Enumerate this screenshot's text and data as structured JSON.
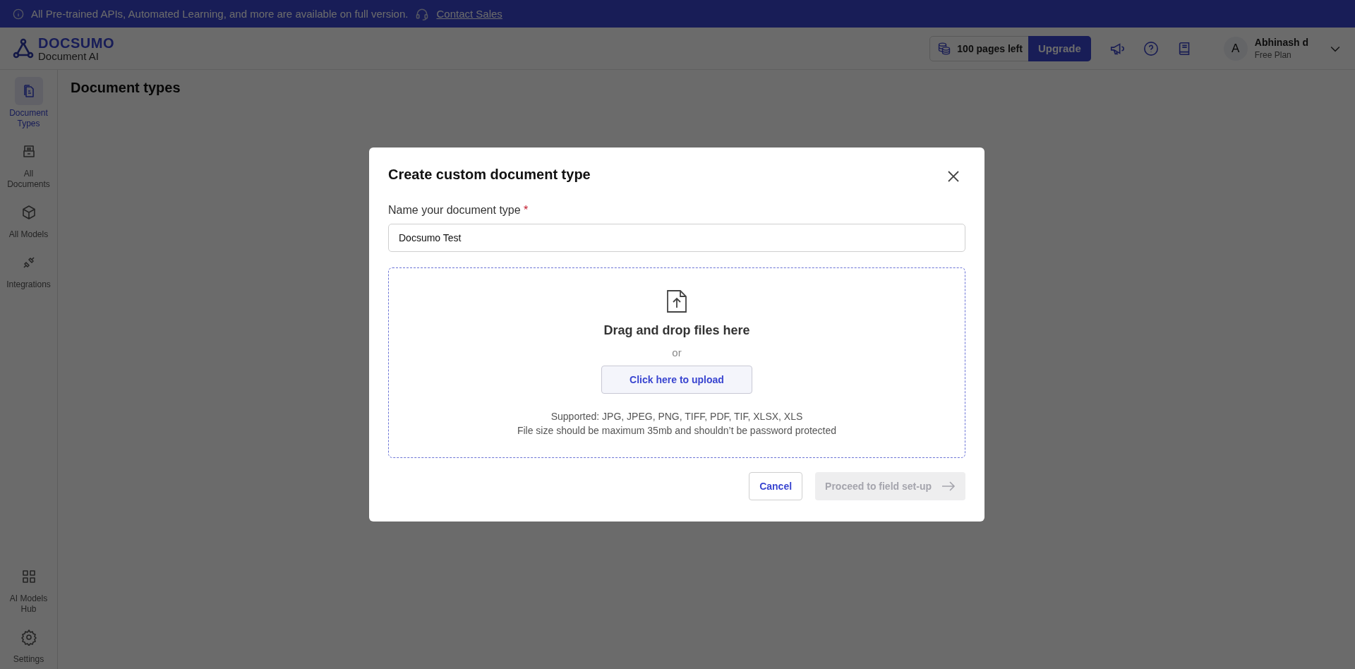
{
  "banner": {
    "text": "All Pre-trained APIs, Automated Learning, and more are available on full version.",
    "link": "Contact Sales"
  },
  "header": {
    "logo_name": "DOCSUMO",
    "logo_subtitle": "Document AI",
    "pages_left": "100 pages left",
    "upgrade": "Upgrade",
    "user": {
      "initial": "A",
      "name": "Abhinash d",
      "plan": "Free Plan"
    }
  },
  "sidebar": {
    "items": [
      {
        "kind": "doc-types",
        "label": "Document Types",
        "selected": true
      },
      {
        "kind": "all-docs",
        "label": "All Documents",
        "selected": false
      },
      {
        "kind": "models",
        "label": "All Models",
        "selected": false
      },
      {
        "kind": "integrations",
        "label": "Integrations",
        "selected": false
      }
    ],
    "bottom_items": [
      {
        "kind": "hub",
        "label": "AI Models Hub",
        "selected": false
      },
      {
        "kind": "settings",
        "label": "Settings",
        "selected": false
      }
    ]
  },
  "page": {
    "title": "Document types"
  },
  "modal": {
    "title": "Create custom document type",
    "field_label": "Name your document type",
    "required_mark": "*",
    "field_value": "Docsumo Test",
    "dropzone": {
      "heading": "Drag and drop files here",
      "or": "or",
      "button": "Click here to upload",
      "supported": "Supported: JPG, JPEG, PNG, TIFF, PDF, TIF, XLSX, XLS",
      "note": "File size should be maximum 35mb and shouldn’t be password protected"
    },
    "buttons": [
      {
        "label": "Cancel",
        "disabled": false
      },
      {
        "label": "Proceed to field set-up",
        "disabled": true
      }
    ]
  }
}
